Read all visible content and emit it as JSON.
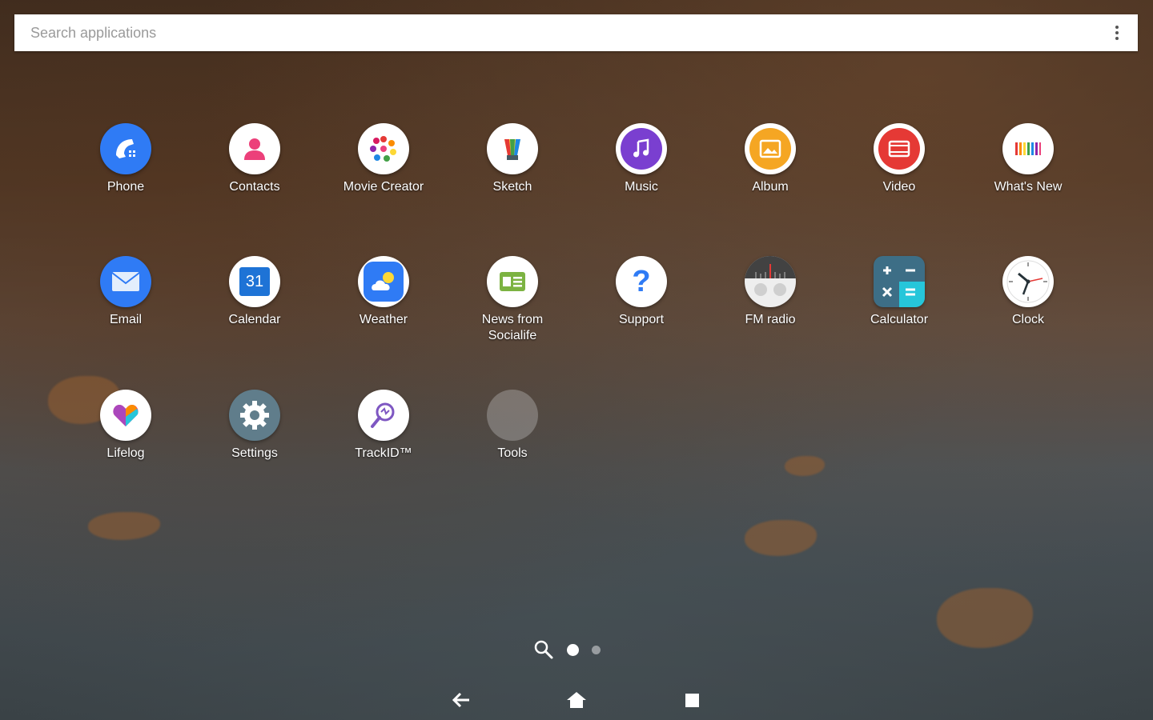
{
  "search": {
    "placeholder": "Search applications"
  },
  "apps": [
    {
      "label": "Phone",
      "icon": "phone-icon",
      "color": "#2f7bf5"
    },
    {
      "label": "Contacts",
      "icon": "contacts-icon",
      "color": "#ffffff"
    },
    {
      "label": "Movie Creator",
      "icon": "movie-creator-icon",
      "color": "#ffffff"
    },
    {
      "label": "Sketch",
      "icon": "sketch-icon",
      "color": "#ffffff"
    },
    {
      "label": "Music",
      "icon": "music-icon",
      "color": "#7a3fd0"
    },
    {
      "label": "Album",
      "icon": "album-icon",
      "color": "#f5a623"
    },
    {
      "label": "Video",
      "icon": "video-icon",
      "color": "#e53935"
    },
    {
      "label": "What's New",
      "icon": "whats-new-icon",
      "color": "#ffffff"
    },
    {
      "label": "Email",
      "icon": "email-icon",
      "color": "#2f7bf5"
    },
    {
      "label": "Calendar",
      "icon": "calendar-icon",
      "color": "#ffffff",
      "day": "31"
    },
    {
      "label": "Weather",
      "icon": "weather-icon",
      "color": "#2f7bf5"
    },
    {
      "label": "News from\nSocialife",
      "icon": "news-icon",
      "color": "#ffffff"
    },
    {
      "label": "Support",
      "icon": "support-icon",
      "color": "#ffffff"
    },
    {
      "label": "FM radio",
      "icon": "radio-icon",
      "color": "#eeeeee"
    },
    {
      "label": "Calculator",
      "icon": "calculator-icon",
      "color": "#3d6e86"
    },
    {
      "label": "Clock",
      "icon": "clock-icon",
      "color": "#ffffff"
    },
    {
      "label": "Lifelog",
      "icon": "lifelog-icon",
      "color": "#ffffff"
    },
    {
      "label": "Settings",
      "icon": "settings-icon",
      "color": "#607d8b"
    },
    {
      "label": "TrackID™",
      "icon": "trackid-icon",
      "color": "#ffffff"
    },
    {
      "label": "Tools",
      "icon": "tools-folder-icon",
      "color": "#8a8a8a"
    }
  ],
  "pager": {
    "pages": 2,
    "current": 1
  },
  "navbar": {
    "back": "back-icon",
    "home": "home-icon",
    "recents": "recents-icon"
  }
}
